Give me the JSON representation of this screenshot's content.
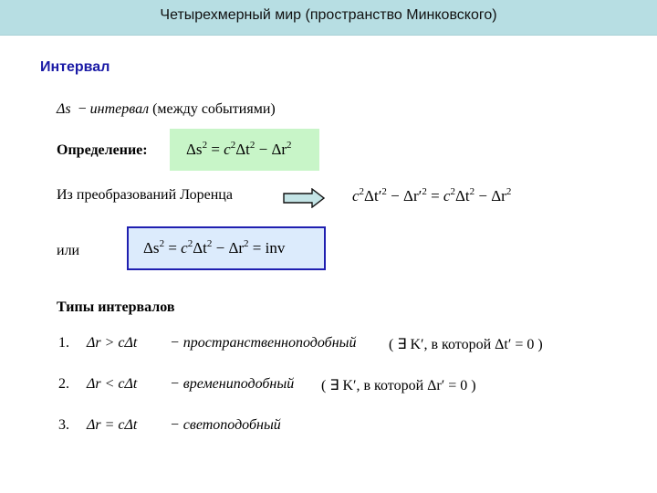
{
  "header": {
    "title": "Четырехмерный мир (пространство Минковского)"
  },
  "section": {
    "title": "Интервал"
  },
  "intro": {
    "symbol": "Δs",
    "dash": "−",
    "term": "интервал",
    "note": "(между событиями)"
  },
  "definition": {
    "label": "Определение:",
    "formula": {
      "lhs": "Δs",
      "eq": "=",
      "c": "c",
      "dt": "Δt",
      "minus": "−",
      "dr": "Δr",
      "exp": "2"
    }
  },
  "lorentz": {
    "label": "Из преобразований Лоренца",
    "arrow_icon": "right-arrow-icon",
    "formula": {
      "c": "c",
      "dtp": "Δt′",
      "minus": "−",
      "drp": "Δr′",
      "eq": "=",
      "dt": "Δt",
      "dr": "Δr",
      "exp": "2"
    }
  },
  "or_row": {
    "label": "или",
    "formula": {
      "lhs": "Δs",
      "eq": "=",
      "c": "c",
      "dt": "Δt",
      "minus": "−",
      "dr": "Δr",
      "inv": "inv",
      "exp": "2"
    }
  },
  "types": {
    "title": "Типы интервалов",
    "items": [
      {
        "num": "1.",
        "lhs": "Δr",
        "op": ">",
        "rhs": "cΔt",
        "name": "− пространственноподобный",
        "note": "( ∃ K′, в которой Δt′ = 0 )"
      },
      {
        "num": "2.",
        "lhs": "Δr",
        "op": "<",
        "rhs": "cΔt",
        "name": "− времениподобный",
        "note": "( ∃ K′, в которой Δr′ = 0 )"
      },
      {
        "num": "3.",
        "lhs": "Δr",
        "op": "=",
        "rhs": "cΔt",
        "name": "− светоподобный",
        "note": ""
      }
    ]
  },
  "colors": {
    "header_bg": "#b7dee3",
    "section_title": "#1a1aa6",
    "green_box": "#c8f5c8",
    "blue_box_bg": "#dcebfc",
    "blue_box_border": "#1f1fb0",
    "arrow_fill": "#c4e4e6"
  }
}
